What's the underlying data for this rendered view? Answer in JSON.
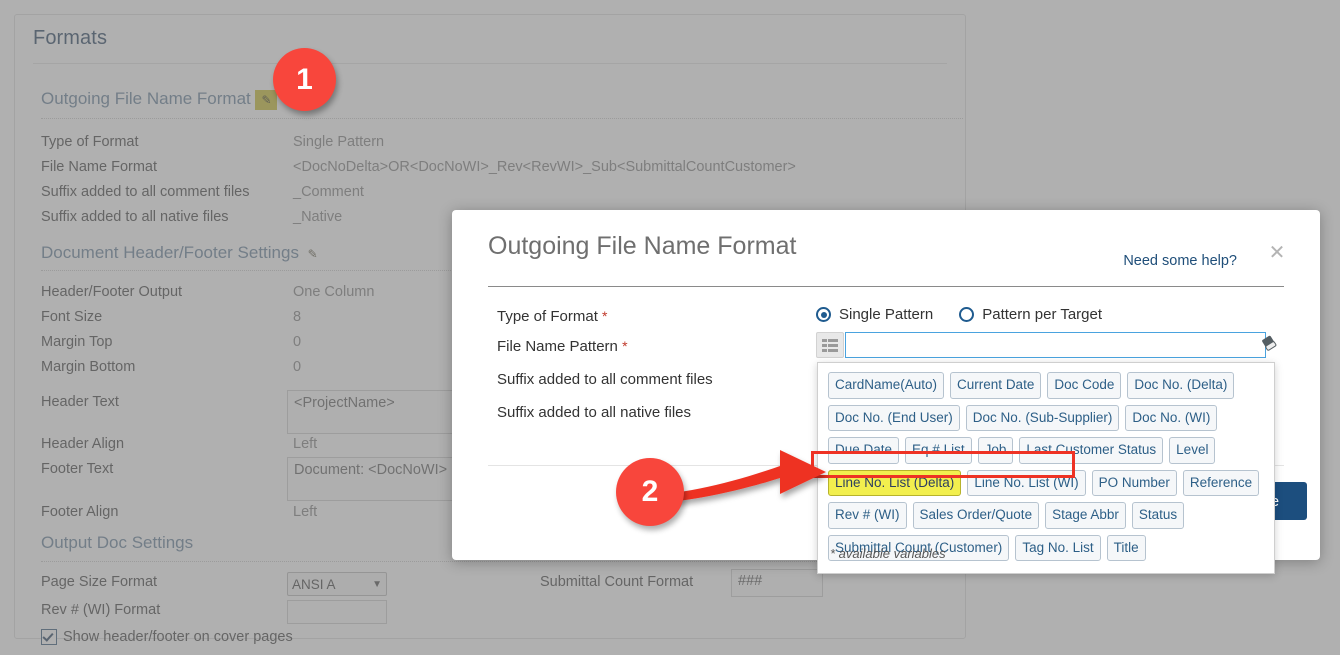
{
  "background": {
    "card_title": "Formats",
    "sections": [
      {
        "heading": "Outgoing File Name Format",
        "edit_icon": "pencil-icon"
      },
      {
        "heading": "Document Header/Footer Settings",
        "edit_icon": "pencil-icon"
      },
      {
        "heading": "Output Doc Settings",
        "edit_icon": ""
      }
    ],
    "outgoing_fields": [
      {
        "label": "Type of Format",
        "value": "Single Pattern"
      },
      {
        "label": "File Name Format",
        "value": "<DocNoDelta>OR<DocNoWI>_Rev<RevWI>_Sub<SubmittalCountCustomer>"
      },
      {
        "label": "Suffix added to all comment files",
        "value": "_Comment"
      },
      {
        "label": "Suffix added to all native files",
        "value": "_Native"
      }
    ],
    "headerfooter_fields": [
      {
        "label": "Header/Footer Output",
        "value": "One Column"
      },
      {
        "label": "Font Size",
        "value": "8"
      },
      {
        "label": "Margin Top",
        "value": "0"
      },
      {
        "label": "Margin Bottom",
        "value": "0"
      },
      {
        "label": "Header Text",
        "value": "<ProjectName>"
      },
      {
        "label": "Header Align",
        "value": "Left"
      },
      {
        "label": "Footer Text",
        "value": "Document: <DocNoWI> Pa"
      },
      {
        "label": "Footer Align",
        "value": "Left"
      }
    ],
    "output_fields": [
      {
        "label": "Page Size Format",
        "value": "ANSI A"
      },
      {
        "label": "Rev # (WI) Format",
        "value": ""
      }
    ],
    "checkbox": {
      "label": "Show header/footer on cover pages",
      "checked": true
    },
    "submittal": {
      "label": "Submittal Count Format",
      "value": "###"
    }
  },
  "modal": {
    "title": "Outgoing File Name Format",
    "help_link": "Need some help?",
    "close_icon": "close-icon",
    "fields": {
      "type_of_format_label": "Type of Format",
      "file_name_pattern_label": "File Name Pattern",
      "suffix_comment_label": "Suffix added to all comment files",
      "suffix_native_label": "Suffix added to all native files",
      "required_mark": "*"
    },
    "radios": [
      {
        "label": "Single Pattern",
        "selected": true
      },
      {
        "label": "Pattern per Target",
        "selected": false
      }
    ],
    "pattern_input": {
      "value": "",
      "placeholder": ""
    },
    "grid_icon": "list-grid-icon",
    "eraser_icon": "eraser-icon",
    "save_label": "Save"
  },
  "dropdown": {
    "note": "* available variables",
    "rows": [
      [
        {
          "label": "CardName(Auto)",
          "highlighted": false
        },
        {
          "label": "Current Date",
          "highlighted": false
        },
        {
          "label": "Doc Code",
          "highlighted": false
        },
        {
          "label": "Doc No. (Delta)",
          "highlighted": false
        }
      ],
      [
        {
          "label": "Doc No. (End User)",
          "highlighted": false
        },
        {
          "label": "Doc No. (Sub-Supplier)",
          "highlighted": false
        },
        {
          "label": "Doc No. (WI)",
          "highlighted": false
        }
      ],
      [
        {
          "label": "Due Date",
          "highlighted": false
        },
        {
          "label": "Eq # List",
          "highlighted": false
        },
        {
          "label": "Job",
          "highlighted": false
        },
        {
          "label": "Last Customer Status",
          "highlighted": false
        },
        {
          "label": "Level",
          "highlighted": false
        }
      ],
      [
        {
          "label": "Line No. List (Delta)",
          "highlighted": true
        },
        {
          "label": "Line No. List (WI)",
          "highlighted": false
        },
        {
          "label": "PO Number",
          "highlighted": false
        },
        {
          "label": "Reference",
          "highlighted": false
        }
      ],
      [
        {
          "label": "Rev # (WI)",
          "highlighted": false
        },
        {
          "label": "Sales Order/Quote",
          "highlighted": false
        },
        {
          "label": "Stage Abbr",
          "highlighted": false
        },
        {
          "label": "Status",
          "highlighted": false
        }
      ],
      [
        {
          "label": "Submittal Count (Customer)",
          "highlighted": false
        },
        {
          "label": "Tag No. List",
          "highlighted": false
        },
        {
          "label": "Title",
          "highlighted": false
        }
      ]
    ]
  },
  "annotations": {
    "marker_1": "1",
    "marker_2": "2",
    "marker_color": "#f8463c",
    "highlight_color": "#f2ef4e",
    "outline_color": "#ee3224"
  }
}
